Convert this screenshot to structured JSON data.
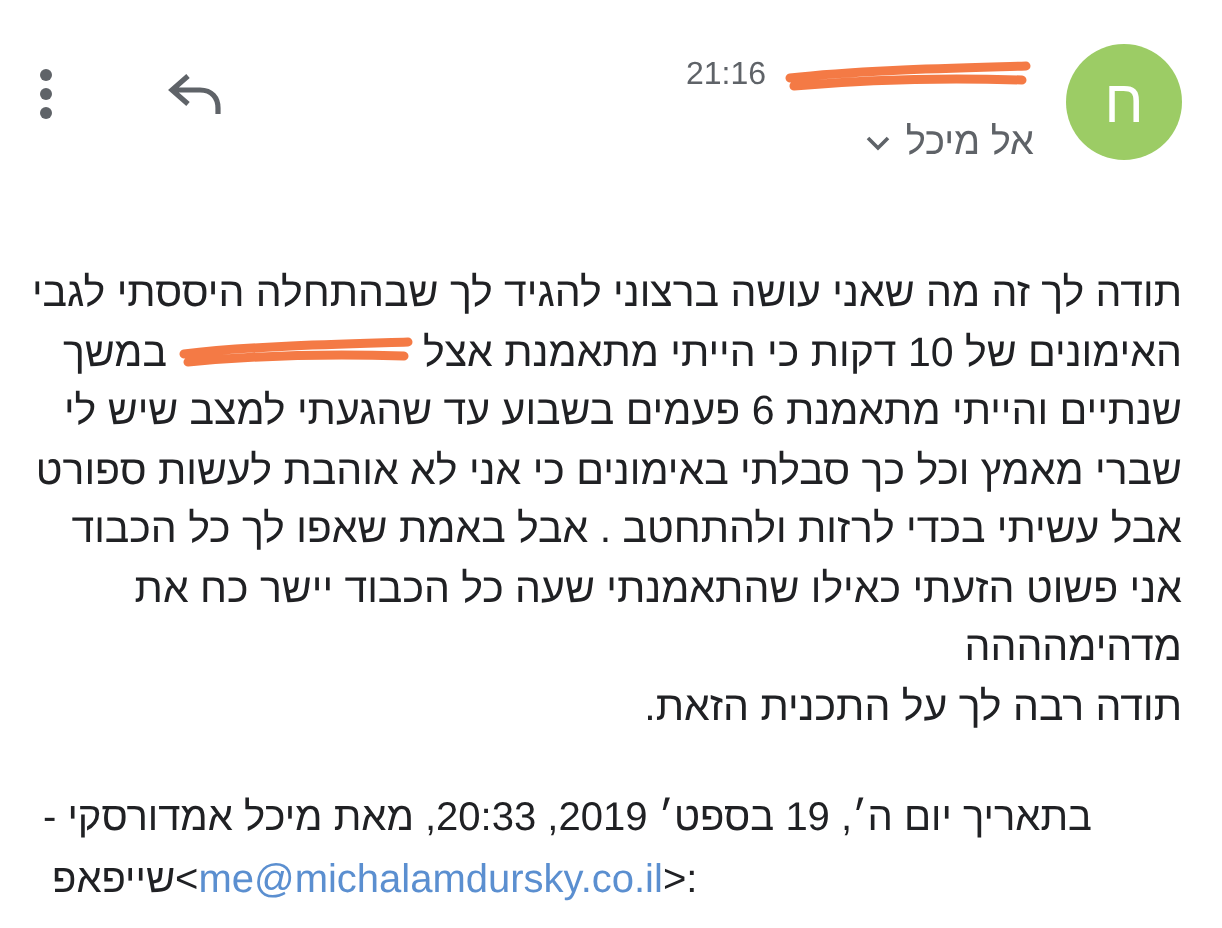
{
  "header": {
    "avatar_letter": "ח",
    "time": "21:16",
    "sender_redacted": true,
    "recipient": "אל מיכל",
    "recipient_expanded": false
  },
  "body": [
    {
      "text": "תודה לך זה מה שאני עושה ברצוני להגיד לך שבהתחלה היססתי לגבי"
    },
    {
      "text": "האימונים של 10 דקות כי הייתי מתאמנת אצל",
      "redaction": true,
      "tail": "במשך"
    },
    {
      "text": "שנתיים והייתי מתאמנת 6 פעמים בשבוע עד שהגעתי למצב שיש לי"
    },
    {
      "text": "שברי מאמץ וכל כך סבלתי באימונים כי אני לא אוהבת לעשות ספורט"
    },
    {
      "text": "אבל עשיתי בכדי לרזות ולהתחטב . אבל באמת שאפו לך כל הכבוד"
    },
    {
      "text": "אני פשוט הזעתי כאילו שהתאמנתי שעה כל הכבוד יישר כח את"
    },
    {
      "text": "מדהימהההה"
    },
    {
      "text": "תודה רבה לך על התכנית הזאת."
    }
  ],
  "quote": {
    "line1": "בתאריך יום ה׳, 19 בספט׳ 2019, 20:33, מאת מיכל אמדורסקי -",
    "name": "שייפאפ",
    "open": "<",
    "email": "me@michalamdursky.co.il",
    "close": ">:"
  }
}
